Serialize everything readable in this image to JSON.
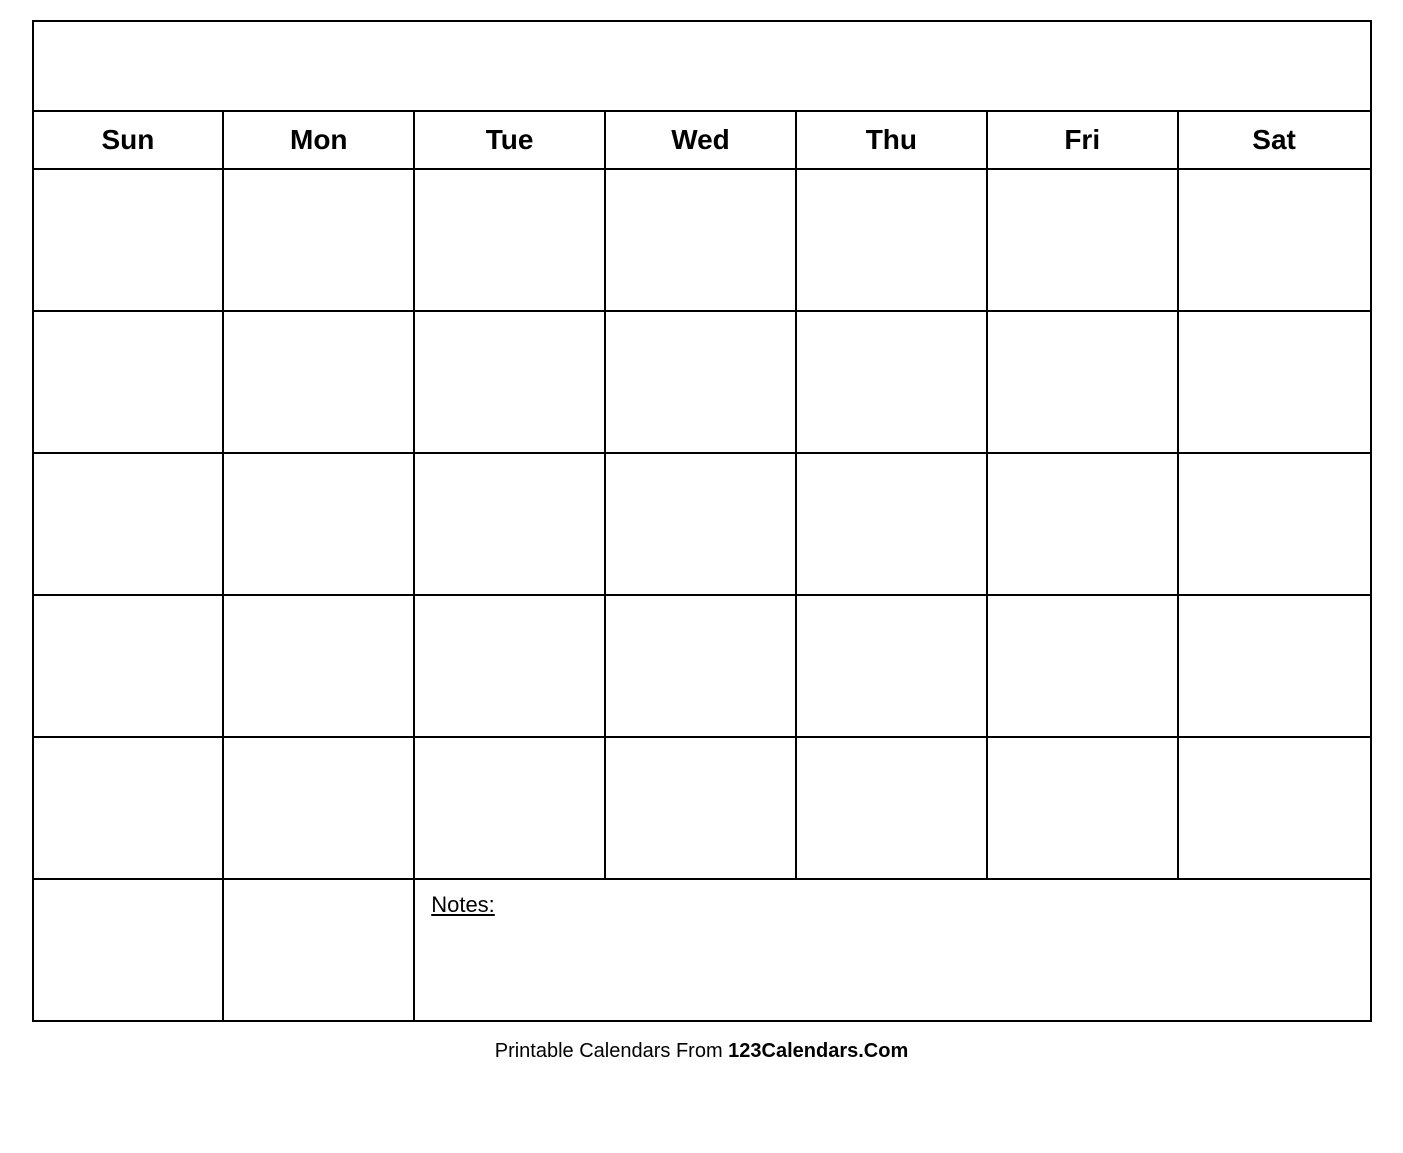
{
  "calendar": {
    "title": "",
    "days": [
      "Sun",
      "Mon",
      "Tue",
      "Wed",
      "Thu",
      "Fri",
      "Sat"
    ],
    "rows": 5,
    "notes_label": "Notes:"
  },
  "footer": {
    "text_normal": "Printable Calendars From ",
    "text_bold": "123Calendars.Com"
  }
}
